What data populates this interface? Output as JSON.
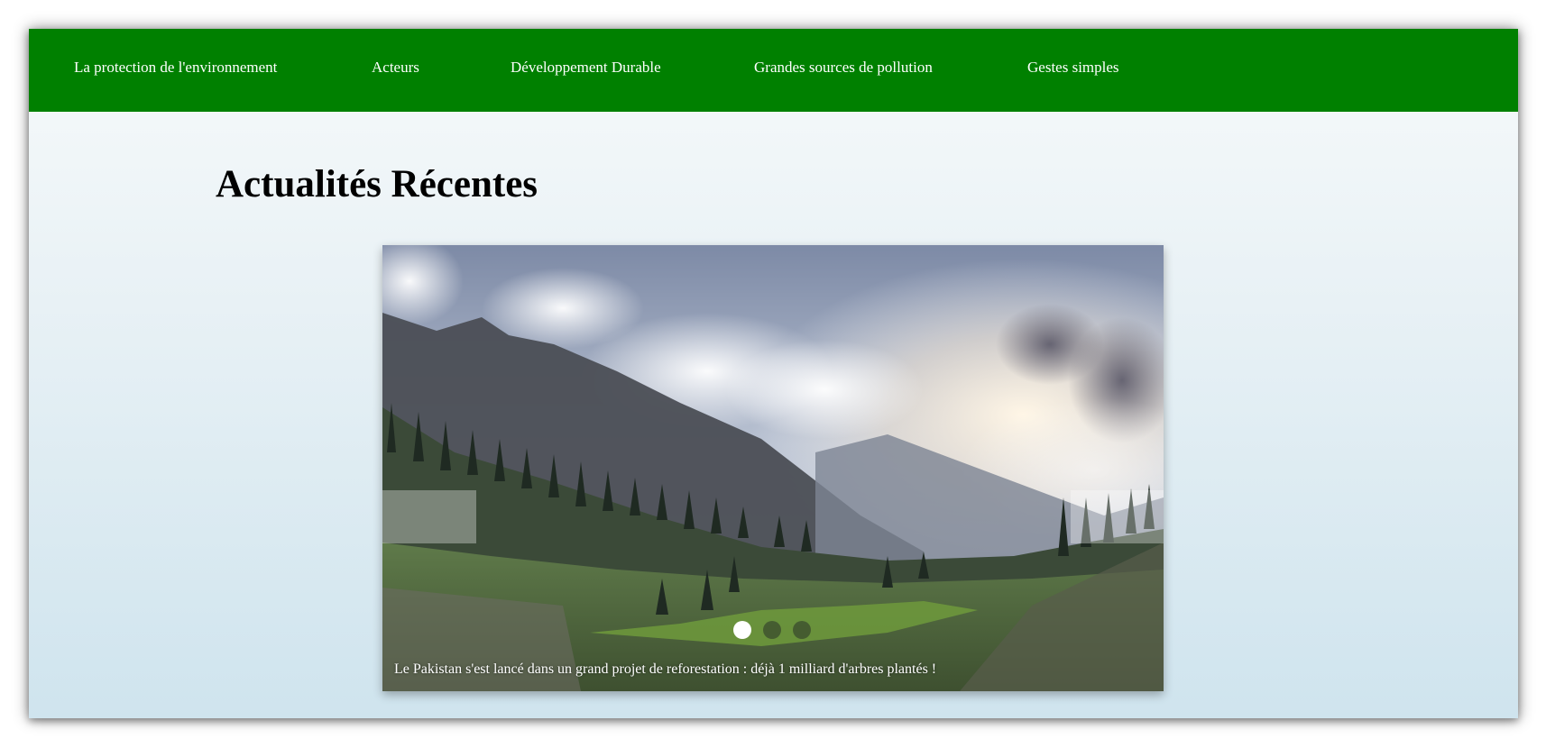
{
  "nav": {
    "items": [
      {
        "label": "La protection de l'environnement"
      },
      {
        "label": "Acteurs"
      },
      {
        "label": "Développement Durable"
      },
      {
        "label": "Grandes sources de pollution"
      },
      {
        "label": "Gestes simples"
      }
    ]
  },
  "main": {
    "title": "Actualités Récentes"
  },
  "slider": {
    "caption": "Le Pakistan s'est lancé dans un grand projet de reforestation : déjà 1 milliard d'arbres plantés !",
    "dots": [
      {
        "active": true
      },
      {
        "active": false
      },
      {
        "active": false
      }
    ],
    "image": "mountain-valley-landscape-photo"
  },
  "colors": {
    "nav_bg": "#008000",
    "nav_text": "#ffffff"
  }
}
